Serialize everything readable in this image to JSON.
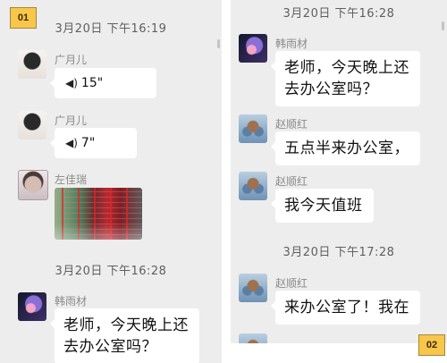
{
  "panels": [
    {
      "badge": "01",
      "timestamps": [
        "3月20日 下午16:19",
        "3月20日 下午16:28"
      ],
      "messages": [
        {
          "sender": "广月儿",
          "type": "voice",
          "duration": "15\""
        },
        {
          "sender": "广月儿",
          "type": "voice",
          "duration": "7\""
        },
        {
          "sender": "左佳瑞",
          "type": "image"
        },
        {
          "sender": "韩雨材",
          "type": "text",
          "lines": [
            "老师，今天晚上还",
            "去办公室吗？"
          ]
        }
      ]
    },
    {
      "badge": "02",
      "timestamps": [
        "3月20日 下午16:28",
        "3月20日 下午17:28"
      ],
      "messages": [
        {
          "sender": "韩雨材",
          "type": "text",
          "lines": [
            "老师，今天晚上还",
            "去办公室吗？"
          ]
        },
        {
          "sender": "赵顺红",
          "type": "text",
          "lines": [
            "五点半来办公室，"
          ]
        },
        {
          "sender": "赵顺红",
          "type": "text",
          "lines": [
            "我今天值班"
          ]
        },
        {
          "sender": "赵顺红",
          "type": "text",
          "lines": [
            "来办公室了！我在"
          ]
        }
      ]
    }
  ],
  "icons": {
    "voice": "voice-wave-icon",
    "avatars": [
      "female-avatar-icon",
      "girl-avatar-icon",
      "anime-avatar-icon",
      "flowers-avatar-icon"
    ]
  },
  "colors": {
    "chat_background": "#ededed",
    "bubble": "#ffffff",
    "badge": "#f7c64a",
    "timestamp_text": "#5f5f5f",
    "sender_text": "#8a8a8a"
  }
}
